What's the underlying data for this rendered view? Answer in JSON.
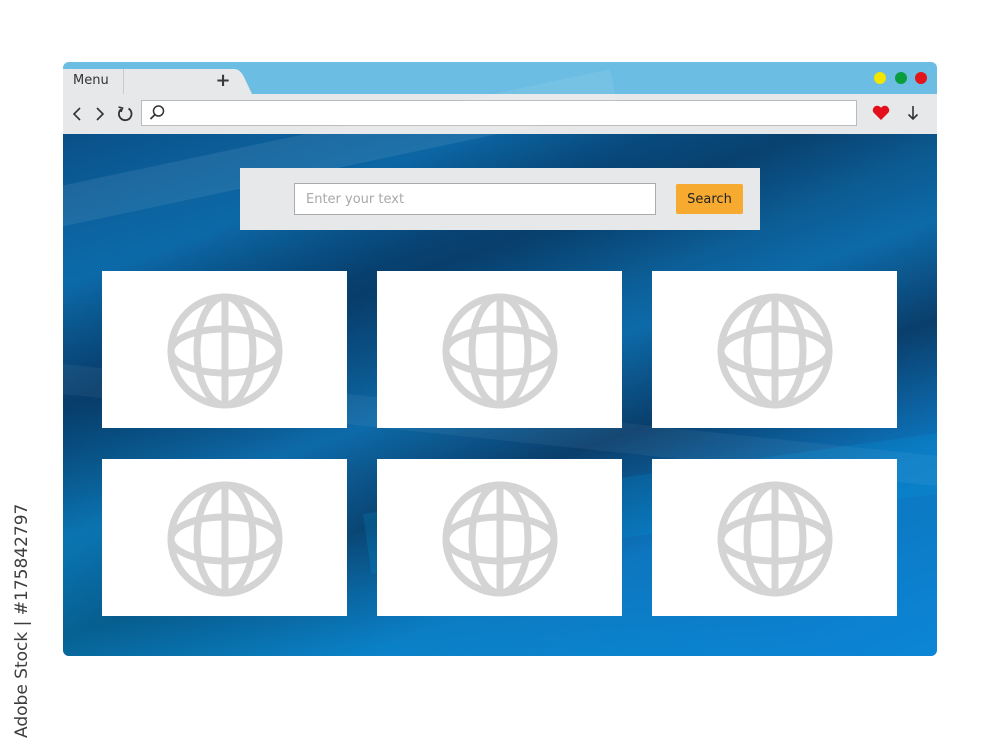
{
  "browser": {
    "menu_label": "Menu",
    "new_tab_symbol": "+",
    "window_controls": [
      {
        "name": "minimize",
        "color": "#f2e500"
      },
      {
        "name": "maximize",
        "color": "#0a9d3e"
      },
      {
        "name": "close",
        "color": "#e3151b"
      }
    ],
    "address_value": "",
    "accent_titlebar": "#6bbde3"
  },
  "icons": {
    "back": "chevron-left-icon",
    "forward": "chevron-right-icon",
    "reload": "reload-icon",
    "search": "search-icon",
    "favorite": "heart-icon",
    "download": "download-arrow-icon",
    "tile": "globe-icon"
  },
  "search": {
    "placeholder": "Enter your text",
    "button_label": "Search",
    "button_color": "#f6aa30"
  },
  "tiles": [
    {
      "icon": "globe"
    },
    {
      "icon": "globe"
    },
    {
      "icon": "globe"
    },
    {
      "icon": "globe"
    },
    {
      "icon": "globe"
    },
    {
      "icon": "globe"
    }
  ],
  "watermark": {
    "side_text": "Adobe Stock | #175842797"
  }
}
